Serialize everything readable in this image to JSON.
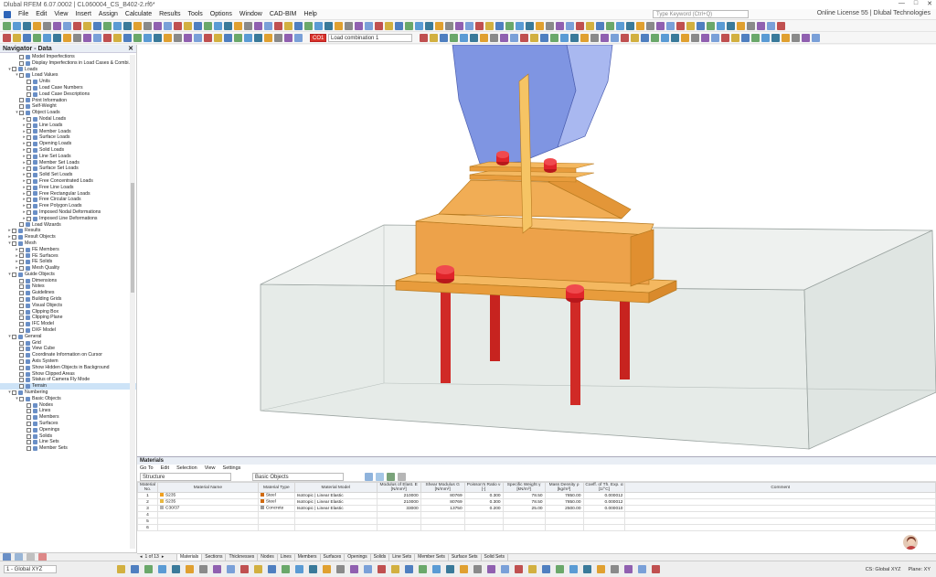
{
  "titlebar": {
    "text": "Dlubal RFEM 6.07.0002 | CL060004_CS_B402-2.rf6*"
  },
  "menubar": {
    "items": [
      "File",
      "Edit",
      "View",
      "Insert",
      "Assign",
      "Calculate",
      "Results",
      "Tools",
      "Options",
      "Window",
      "CAD-BIM",
      "Help"
    ],
    "search_placeholder": "Type Keyword (Ctrl+Q)",
    "license_text": "Online License 55 | Dlubal Technologies"
  },
  "toolbar": {
    "load_case_tag": "CO1",
    "load_case": "Load combination 1"
  },
  "navigator": {
    "title": "Navigator - Data",
    "items": [
      {
        "indent": 1,
        "exp": "",
        "label": "Model Imperfections"
      },
      {
        "indent": 1,
        "exp": "",
        "label": "Display Imperfections in Load Cases & Combi..."
      },
      {
        "indent": 0,
        "exp": "v",
        "label": "Loads"
      },
      {
        "indent": 1,
        "exp": "v",
        "label": "Load Values"
      },
      {
        "indent": 2,
        "exp": "",
        "label": "Units"
      },
      {
        "indent": 2,
        "exp": "",
        "label": "Load Case Numbers"
      },
      {
        "indent": 2,
        "exp": "",
        "label": "Load Case Descriptions"
      },
      {
        "indent": 1,
        "exp": "",
        "label": "Print Information"
      },
      {
        "indent": 1,
        "exp": "",
        "label": "Self-Weight"
      },
      {
        "indent": 1,
        "exp": "v",
        "label": "Object Loads"
      },
      {
        "indent": 2,
        "exp": ">",
        "label": "Nodal Loads"
      },
      {
        "indent": 2,
        "exp": ">",
        "label": "Line Loads"
      },
      {
        "indent": 2,
        "exp": ">",
        "label": "Member Loads"
      },
      {
        "indent": 2,
        "exp": ">",
        "label": "Surface Loads"
      },
      {
        "indent": 2,
        "exp": ">",
        "label": "Opening Loads"
      },
      {
        "indent": 2,
        "exp": ">",
        "label": "Solid Loads"
      },
      {
        "indent": 2,
        "exp": ">",
        "label": "Line Set Loads"
      },
      {
        "indent": 2,
        "exp": ">",
        "label": "Member Set Loads"
      },
      {
        "indent": 2,
        "exp": ">",
        "label": "Surface Set Loads"
      },
      {
        "indent": 2,
        "exp": ">",
        "label": "Solid Set Loads"
      },
      {
        "indent": 2,
        "exp": ">",
        "label": "Free Concentrated Loads"
      },
      {
        "indent": 2,
        "exp": ">",
        "label": "Free Line Loads"
      },
      {
        "indent": 2,
        "exp": ">",
        "label": "Free Rectangular Loads"
      },
      {
        "indent": 2,
        "exp": ">",
        "label": "Free Circular Loads"
      },
      {
        "indent": 2,
        "exp": ">",
        "label": "Free Polygon Loads"
      },
      {
        "indent": 2,
        "exp": ">",
        "label": "Imposed Nodal Deformations"
      },
      {
        "indent": 2,
        "exp": ">",
        "label": "Imposed Line Deformations"
      },
      {
        "indent": 1,
        "exp": "",
        "label": "Load Wizards"
      },
      {
        "indent": 0,
        "exp": ">",
        "label": "Results"
      },
      {
        "indent": 0,
        "exp": ">",
        "label": "Result Objects"
      },
      {
        "indent": 0,
        "exp": "v",
        "label": "Mesh"
      },
      {
        "indent": 1,
        "exp": ">",
        "label": "FE Members"
      },
      {
        "indent": 1,
        "exp": ">",
        "label": "FE Surfaces"
      },
      {
        "indent": 1,
        "exp": ">",
        "label": "FE Solids"
      },
      {
        "indent": 1,
        "exp": ">",
        "label": "Mesh Quality"
      },
      {
        "indent": 0,
        "exp": "v",
        "label": "Guide Objects"
      },
      {
        "indent": 1,
        "exp": "",
        "label": "Dimensions"
      },
      {
        "indent": 1,
        "exp": "",
        "label": "Notes"
      },
      {
        "indent": 1,
        "exp": "",
        "label": "Guidelines"
      },
      {
        "indent": 1,
        "exp": "",
        "label": "Building Grids"
      },
      {
        "indent": 1,
        "exp": "",
        "label": "Visual Objects"
      },
      {
        "indent": 1,
        "exp": "",
        "label": "Clipping Box"
      },
      {
        "indent": 1,
        "exp": "",
        "label": "Clipping Plane"
      },
      {
        "indent": 1,
        "exp": "",
        "label": "IFC Model"
      },
      {
        "indent": 1,
        "exp": "",
        "label": "DXF Model"
      },
      {
        "indent": 0,
        "exp": "v",
        "label": "General"
      },
      {
        "indent": 1,
        "exp": "",
        "label": "Grid"
      },
      {
        "indent": 1,
        "exp": "",
        "label": "View Cube"
      },
      {
        "indent": 1,
        "exp": "",
        "label": "Coordinate Information on Cursor"
      },
      {
        "indent": 1,
        "exp": "",
        "label": "Axis System"
      },
      {
        "indent": 1,
        "exp": "",
        "label": "Show Hidden Objects in Background"
      },
      {
        "indent": 1,
        "exp": "",
        "label": "Show Clipped Areas"
      },
      {
        "indent": 1,
        "exp": "",
        "label": "Status of Camera Fly Mode"
      },
      {
        "indent": 1,
        "exp": "",
        "label": "Terrain",
        "selected": true
      },
      {
        "indent": 0,
        "exp": "v",
        "label": "Numbering"
      },
      {
        "indent": 1,
        "exp": "v",
        "label": "Basic Objects"
      },
      {
        "indent": 2,
        "exp": "",
        "label": "Nodes"
      },
      {
        "indent": 2,
        "exp": "",
        "label": "Lines"
      },
      {
        "indent": 2,
        "exp": "",
        "label": "Members"
      },
      {
        "indent": 2,
        "exp": "",
        "label": "Surfaces"
      },
      {
        "indent": 2,
        "exp": "",
        "label": "Openings"
      },
      {
        "indent": 2,
        "exp": "",
        "label": "Solids"
      },
      {
        "indent": 2,
        "exp": "",
        "label": "Line Sets"
      },
      {
        "indent": 2,
        "exp": "",
        "label": "Member Sets"
      }
    ]
  },
  "materials": {
    "title": "Materials",
    "menu": [
      "Go To",
      "Edit",
      "Selection",
      "View",
      "Settings"
    ],
    "filter": "Structure",
    "objects": "Basic Objects",
    "headers": [
      "Material No.",
      "Material Name",
      "Material Type",
      "Material Model",
      "Modulus of Elast. E [N/mm²]",
      "Shear Modulus G [N/mm²]",
      "Poisson's Ratio ν [-]",
      "Specific Weight γ [kN/m³]",
      "Mass Density ρ [kg/m³]",
      "Coeff. of Th. Exp. α [1/°C]",
      "Comment"
    ],
    "rows": [
      {
        "no": "1",
        "name": "S235",
        "color": "#f0a020",
        "type": "Steel",
        "type_color": "#d06a10",
        "model": "Isotropic | Linear Elastic",
        "e": "210000",
        "g": "80769",
        "nu": "0.300",
        "gamma": "78.50",
        "rho": "7850.00",
        "alpha": "0.000012",
        "comment": ""
      },
      {
        "no": "2",
        "name": "S235",
        "color": "#e8b840",
        "type": "Steel",
        "type_color": "#d06a10",
        "model": "Isotropic | Linear Elastic",
        "e": "210000",
        "g": "80769",
        "nu": "0.300",
        "gamma": "78.50",
        "rho": "7850.00",
        "alpha": "0.000012",
        "comment": ""
      },
      {
        "no": "3",
        "name": "C30/37",
        "color": "#b0b0b0",
        "type": "Concrete",
        "type_color": "#9a9a9a",
        "model": "Isotropic | Linear Elastic",
        "e": "33000",
        "g": "13750",
        "nu": "0.200",
        "gamma": "25.00",
        "rho": "2500.00",
        "alpha": "0.000010",
        "comment": ""
      },
      {
        "no": "4",
        "name": "",
        "color": "",
        "type": "",
        "type_color": "",
        "model": "",
        "e": "",
        "g": "",
        "nu": "",
        "gamma": "",
        "rho": "",
        "alpha": "",
        "comment": ""
      },
      {
        "no": "5",
        "name": "",
        "color": "",
        "type": "",
        "type_color": "",
        "model": "",
        "e": "",
        "g": "",
        "nu": "",
        "gamma": "",
        "rho": "",
        "alpha": "",
        "comment": ""
      },
      {
        "no": "6",
        "name": "",
        "color": "",
        "type": "",
        "type_color": "",
        "model": "",
        "e": "",
        "g": "",
        "nu": "",
        "gamma": "",
        "rho": "",
        "alpha": "",
        "comment": ""
      }
    ],
    "pager": "1 of 13",
    "tabs": [
      "Materials",
      "Sections",
      "Thicknesses",
      "Nodes",
      "Lines",
      "Members",
      "Surfaces",
      "Openings",
      "Solids",
      "Line Sets",
      "Member Sets",
      "Surface Sets",
      "Solid Sets"
    ]
  },
  "status": {
    "cs": "1 - Global XYZ",
    "right": [
      "CS: Global XYZ",
      "Plane: XY"
    ]
  },
  "colors": {
    "steel": "#f0a040",
    "bolt": "#d91c24",
    "column": "#7b90e0",
    "concrete": "#e7ece9"
  }
}
